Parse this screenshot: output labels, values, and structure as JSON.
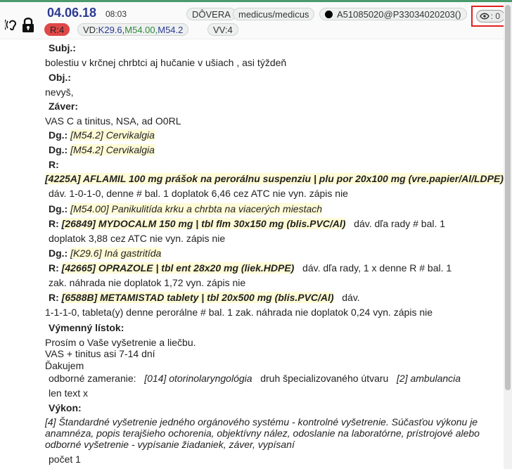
{
  "header": {
    "date": "04.06.18",
    "time": "08:03",
    "trust_label": "DÔVERA",
    "user_label": "medicus/medicus",
    "patient_id": "A51085020@P33034020203()",
    "risk_badge": "R:4",
    "vd_prefix": "VD:",
    "vd_code1": "K29.6,",
    "vd_code2": "M54.00,",
    "vd_code3": "M54.2",
    "vv_label": "VV:4",
    "eye_count": ": 0"
  },
  "record": {
    "subj_label": "Subj.:",
    "subj_text": "bolestiu v krčnej chrbtci aj hučanie v ušiach , asi týždeň",
    "obj_label": "Obj.:",
    "obj_text": "nevyš,",
    "zaver_label": "Záver:",
    "zaver_text": "VAS C a tinitus, NSA, ad O0RL",
    "dg_label": "Dg.:",
    "dg1": "[M54.2] Cervikalgia",
    "dg2": "[M54.2] Cervikalgia",
    "r_label": "R:",
    "drug1_name": "[4225A] AFLAMIL 100 mg prášok na perorálnu suspenziu | plu por 20x100 mg (vre.papier/Al/LDPE)",
    "drug1_line": "dáv.   1-0-1-0, denne   # bal.   1   doplatok   6,46   cez ATC   nie   vyn. zápis   nie",
    "dg3": "[M54.00] Panikulitída krku a chrbta na viacerých miestach",
    "drug2_name": "[26849] MYDOCALM 150 mg | tbl flm 30x150 mg (blis.PVC/Al)",
    "drug2_tail": "dáv.   dľa rady   # bal.   1",
    "drug2_line": "doplatok   3,88   cez ATC   nie   vyn. zápis   nie",
    "dg4": "[K29.6] Iná gastritída",
    "drug3_name": "[42665] OPRAZOLE | tbl ent 28x20 mg (liek.HDPE)",
    "drug3_tail": "dáv.   dľa rady, 1 x denne R   # bal.   1",
    "drug3_line": "zak. náhrada   nie   doplatok   1,72   vyn. zápis   nie",
    "drug4_name": "[6588B] METAMISTAD tablety | tbl 20x500 mg (blis.PVC/Al)",
    "drug4_tail": "dáv.",
    "drug4_line": "1-1-1-0, tableta(y) denne perorálne   # bal.   1   zak. náhrada   nie   doplatok   0,24   vyn. zápis   nie",
    "vymenny_label": "Výmenný lístok:",
    "vymenny_line1": "Prosím o Vaše vyšetrenie a liečbu.",
    "vymenny_line2": "VAS + tinitus asi 7-14 dní",
    "vymenny_line3": "Ďakujem",
    "odb_label": "odborné zameranie:",
    "odb_value": "[014] otorinolaryngológia",
    "druh_label": "druh špecializovaného útvaru",
    "druh_value": "[2] ambulancia",
    "len_text": "len text   x",
    "vykon_label": "Výkon:",
    "vykon_text": "[4] Štandardné vyšetrenie jedného orgánového systému - kontrolné vyšetrenie. Súčasťou výkonu je anamnéza, popis terajšieho ochorenia, objektívny nález, odoslanie na laboratórne, prístrojové alebo odborné vyšetrenie - vypísanie žiadaniek, záver, vypísaní",
    "pocet": "počet   1"
  },
  "colors": {
    "accent": "#2c3a93",
    "highlight": "#fffbd6",
    "risk": "#e04848",
    "alert_border": "#e02020"
  }
}
